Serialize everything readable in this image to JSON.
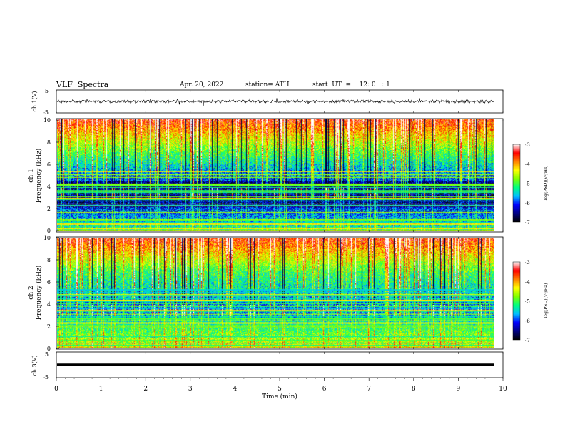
{
  "header": {
    "title": "VLF  Spectra",
    "date": "Apr. 20, 2022",
    "station": "station= ATH",
    "start": "start  UT  =    12: 0   : 1"
  },
  "chart_data": [
    {
      "type": "line",
      "panel": "ch1",
      "ylabel": "ch.1(V)",
      "ylim": [
        -5,
        5
      ],
      "yticks": [
        "5",
        "-5"
      ],
      "xlim": [
        0,
        10
      ],
      "description_signal": "noisy trace near 0 V with spikes",
      "baseline": 0
    },
    {
      "type": "heatmap",
      "panel": "ch1-spectrogram",
      "ylabel": "ch.1\nFrequency (kHz)",
      "ylabel_lines": [
        "ch.1",
        "Frequency (kHz)"
      ],
      "ylim": [
        0,
        10
      ],
      "yticks": [
        "0",
        "2",
        "4",
        "6",
        "8",
        "10"
      ],
      "xlim": [
        0,
        10
      ],
      "colorbar": {
        "label": "log(PSD)(V²/Hz)",
        "range": [
          -7,
          -3
        ],
        "ticks": [
          "-3",
          "-4",
          "-5",
          "-6",
          "-7"
        ]
      }
    },
    {
      "type": "heatmap",
      "panel": "ch2-spectrogram",
      "ylabel": "ch.2\nFrequency (kHz)",
      "ylabel_lines": [
        "ch.2",
        "Frequency (kHz)"
      ],
      "ylim": [
        0,
        10
      ],
      "yticks": [
        "0",
        "2",
        "4",
        "6",
        "8",
        "10"
      ],
      "xlim": [
        0,
        10
      ],
      "colorbar": {
        "label": "log(PSD)(V²/Hz)",
        "range": [
          -7,
          -3
        ],
        "ticks": [
          "-3",
          "-4",
          "-5",
          "-6",
          "-7"
        ]
      }
    },
    {
      "type": "line",
      "panel": "ch3",
      "ylabel": "ch.3(V)",
      "ylim": [
        -5,
        5
      ],
      "yticks": [
        "5",
        "-5"
      ],
      "xlim": [
        0,
        10
      ],
      "baseline": 0
    }
  ],
  "xaxis": {
    "label": "Time  (min)",
    "ticks": [
      "0",
      "1",
      "2",
      "3",
      "4",
      "5",
      "6",
      "7",
      "8",
      "9",
      "10"
    ]
  },
  "colors": {
    "colormap": [
      "#000000",
      "#000080",
      "#0000ff",
      "#00c0ff",
      "#00ff80",
      "#80ff00",
      "#ffff00",
      "#ff8000",
      "#ff0000",
      "#ffffff"
    ]
  }
}
